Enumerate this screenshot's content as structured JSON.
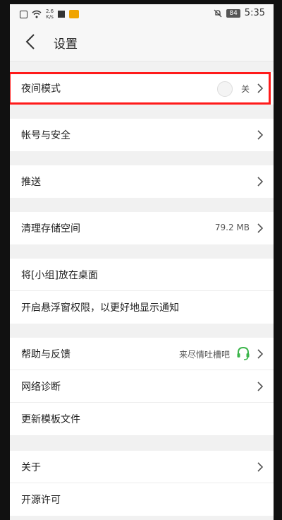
{
  "status_bar": {
    "speed": "2.6\nK/s",
    "battery": "84",
    "time": "5:35"
  },
  "header": {
    "title": "设置"
  },
  "colors": {
    "highlight": "#ff1a1a",
    "feedback_icon": "#3bb54a"
  },
  "sections": [
    {
      "rows": [
        {
          "label": "夜间模式",
          "value": "关"
        }
      ]
    },
    {
      "rows": [
        {
          "label": "帐号与安全"
        }
      ]
    },
    {
      "rows": [
        {
          "label": "推送"
        }
      ]
    },
    {
      "rows": [
        {
          "label": "清理存储空间",
          "value": "79.2 MB"
        }
      ]
    },
    {
      "rows": [
        {
          "label": "将[小组]放在桌面"
        },
        {
          "label": "开启悬浮窗权限，以更好地显示通知"
        }
      ]
    },
    {
      "rows": [
        {
          "label": "帮助与反馈",
          "value": "来尽情吐槽吧"
        },
        {
          "label": "网络诊断"
        },
        {
          "label": "更新模板文件"
        }
      ]
    },
    {
      "rows": [
        {
          "label": "关于"
        },
        {
          "label": "开源许可"
        }
      ]
    }
  ]
}
